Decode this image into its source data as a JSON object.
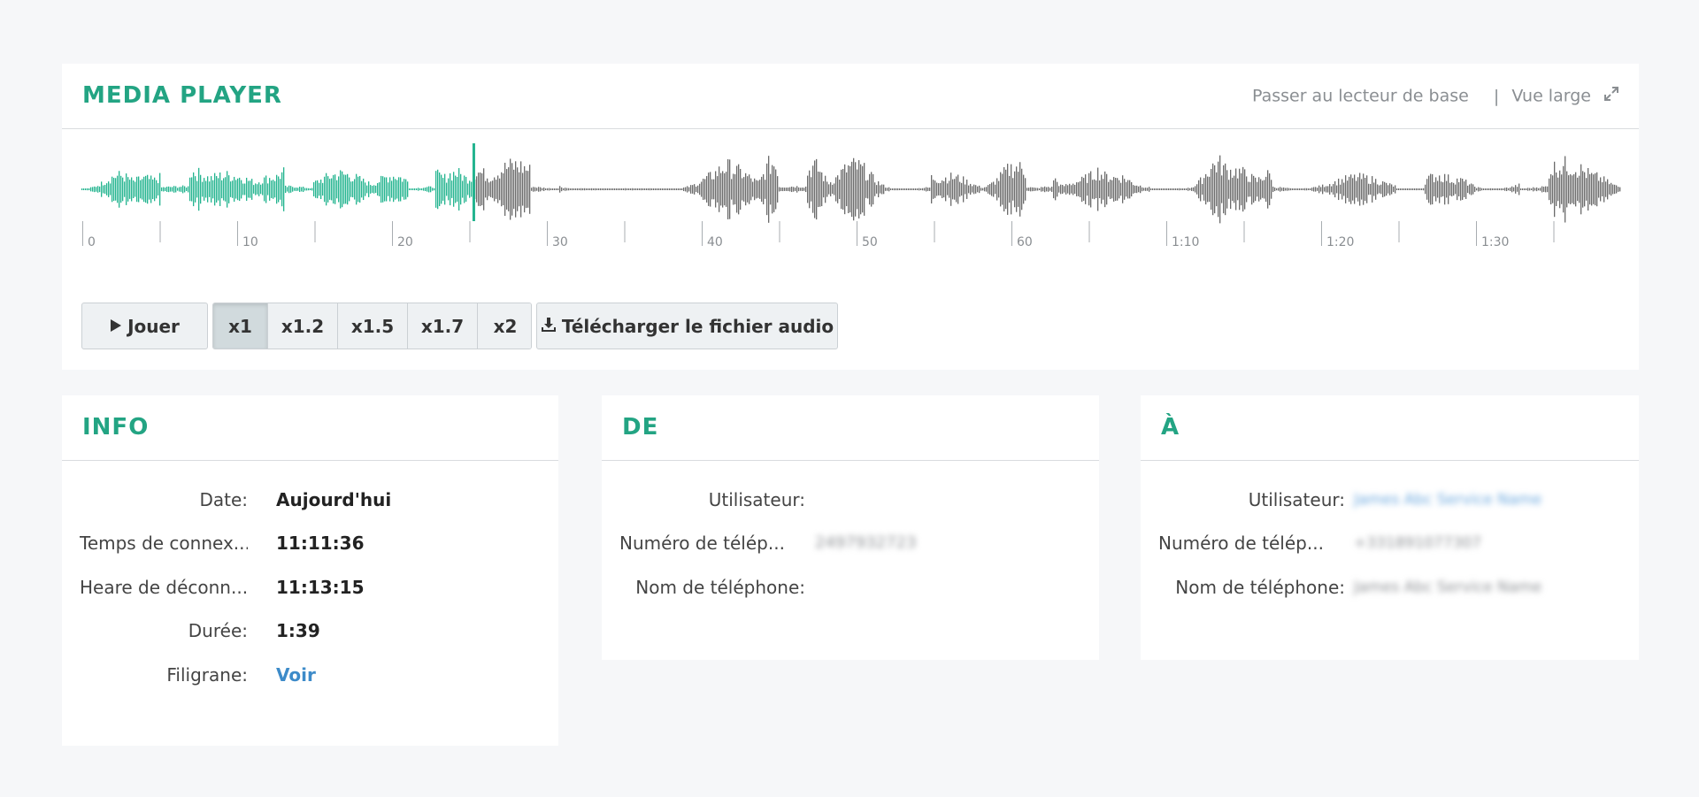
{
  "media": {
    "title": "MEDIA PLAYER",
    "switch_link": "Passer au lecteur de base",
    "separator": "|",
    "wide_link": "Vue large",
    "progress_fraction": 0.254,
    "played_color": "#23b48f",
    "unplayed_color": "#6b6b6b",
    "timeline_labels": [
      "0",
      "10",
      "20",
      "30",
      "40",
      "50",
      "60",
      "1:10",
      "1:20",
      "1:30"
    ],
    "play_label": "Jouer",
    "speeds": [
      {
        "label": "x1",
        "active": true
      },
      {
        "label": "x1.2",
        "active": false
      },
      {
        "label": "x1.5",
        "active": false
      },
      {
        "label": "x1.7",
        "active": false
      },
      {
        "label": "x2",
        "active": false
      }
    ],
    "download_label": "Télécharger le fichier audio"
  },
  "info": {
    "title": "INFO",
    "date_label": "Date:",
    "date_value": "Aujourd'hui",
    "connect_label": "Temps de connex...",
    "connect_value": "11:11:36",
    "disconnect_label": "Heare de déconn...",
    "disconnect_value": "11:13:15",
    "duration_label": "Durée:",
    "duration_value": "1:39",
    "watermark_label": "Filigrane:",
    "watermark_value": "Voir"
  },
  "from": {
    "title": "DE",
    "user_label": "Utilisateur:",
    "phone_number_label": "Numéro de télép...",
    "phone_number_value": "2497932723",
    "phone_name_label": "Nom de téléphone:"
  },
  "to": {
    "title": "À",
    "user_label": "Utilisateur:",
    "user_value": "James Abc Service Name",
    "phone_number_label": "Numéro de télép...",
    "phone_number_value": "+331891077307",
    "phone_name_label": "Nom de téléphone:",
    "phone_name_value": "James Abc Service Name"
  }
}
